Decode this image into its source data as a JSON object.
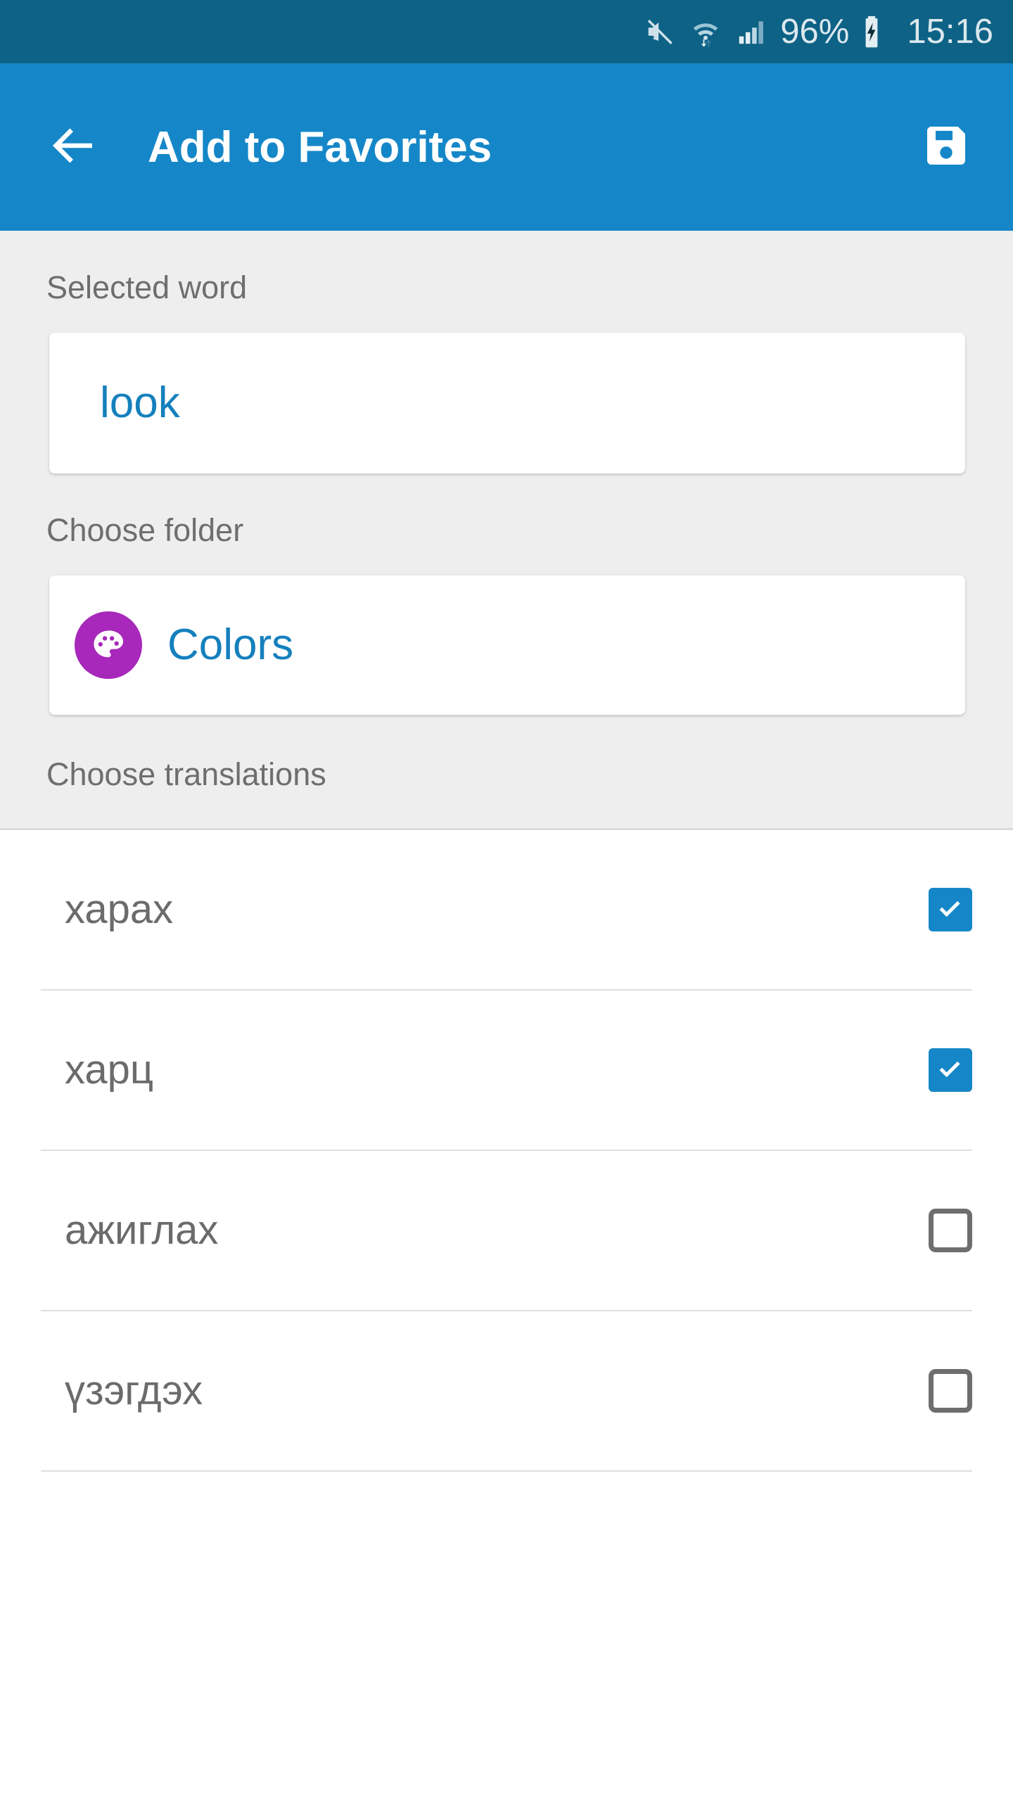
{
  "status_bar": {
    "mute_icon": "mute-icon",
    "wifi_icon": "wifi-transfer-icon",
    "signal_icon": "cellular-signal-icon",
    "battery_percent": "96%",
    "battery_icon": "battery-charging-icon",
    "clock": "15:16",
    "background_color": "#0d6286",
    "text_color": "#dce8ee"
  },
  "app_bar": {
    "back_icon": "back-arrow-icon",
    "title": "Add to Favorites",
    "save_icon": "save-floppy-icon",
    "background_color": "#1587c8",
    "text_color": "#ffffff"
  },
  "form": {
    "selected_word": {
      "label": "Selected word",
      "value": "look",
      "value_color": "#1580bd"
    },
    "choose_folder": {
      "label": "Choose folder",
      "folder_name": "Colors",
      "folder_icon": "palette-icon",
      "folder_icon_color": "#a728ba",
      "value_color": "#1580bd"
    },
    "choose_translations": {
      "label": "Choose translations"
    },
    "background_color": "#eeeeee",
    "label_color": "#6e6e6e"
  },
  "translations": {
    "items": [
      {
        "label": "харах",
        "checked": true
      },
      {
        "label": "харц",
        "checked": true
      },
      {
        "label": "ажиглах",
        "checked": false
      },
      {
        "label": "үзэгдэх",
        "checked": false
      }
    ],
    "checked_color": "#1587c8",
    "unchecked_border_color": "#6e6e6e",
    "label_color": "#6b6b6b"
  }
}
